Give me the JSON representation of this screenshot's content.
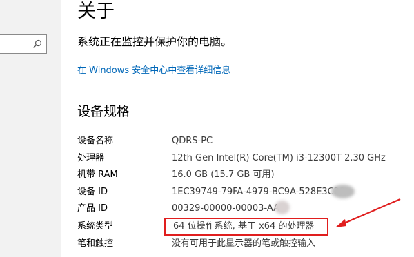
{
  "page": {
    "title": "关于",
    "subtitle": "系统正在监控并保护你的电脑。",
    "security_link": "在 Windows 安全中心中查看详细信息"
  },
  "specs": {
    "heading": "设备规格",
    "rows": [
      {
        "label": "设备名称",
        "value": "QDRS-PC"
      },
      {
        "label": "处理器",
        "value": "12th Gen Intel(R) Core(TM) i3-12300T   2.30 GHz"
      },
      {
        "label": "机带 RAM",
        "value": "16.0 GB (15.7 GB 可用)"
      },
      {
        "label": "设备 ID",
        "value": "1EC39749-79FA-4979-BC9A-528E3C29"
      },
      {
        "label": "产品 ID",
        "value": "00329-00000-00003-AA"
      },
      {
        "label": "系统类型",
        "value": "64 位操作系统, 基于 x64 的处理器"
      },
      {
        "label": "笔和触控",
        "value": "没有可用于此显示器的笔或触控输入"
      }
    ]
  },
  "search": {
    "icon": "search-icon"
  },
  "colors": {
    "link": "#0067b8",
    "highlight": "#e01e1e",
    "nav_bg": "#f2f2f2"
  }
}
